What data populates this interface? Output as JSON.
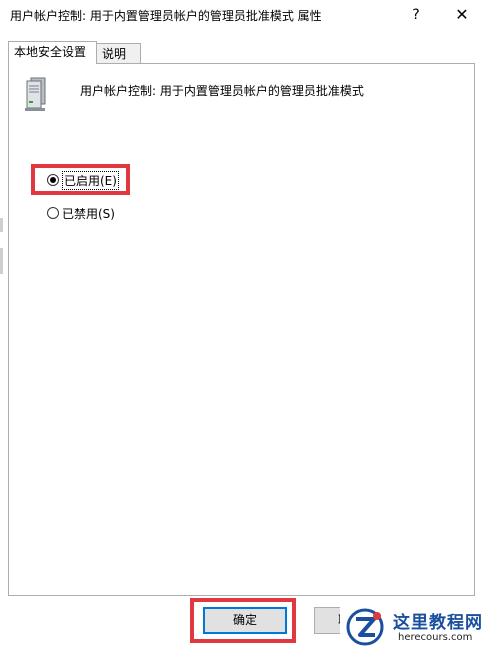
{
  "window": {
    "title": "用户帐户控制: 用于内置管理员帐户的管理员批准模式 属性",
    "help_label": "?",
    "close_label": "✕"
  },
  "tabs": [
    {
      "label": "本地安全设置",
      "active": true
    },
    {
      "label": "说明",
      "active": false
    }
  ],
  "policy": {
    "icon": "server-icon",
    "name": "用户帐户控制: 用于内置管理员帐户的管理员批准模式"
  },
  "options": [
    {
      "label": "已启用(E)",
      "checked": true
    },
    {
      "label": "已禁用(S)",
      "checked": false
    }
  ],
  "buttons": {
    "ok": "确定",
    "cancel": "取"
  },
  "watermark": {
    "site_name": "这里教程网",
    "url": "herecours.com"
  },
  "colors": {
    "highlight": "#e0383e",
    "focus_border": "#0078d7",
    "watermark_text": "#1a4fa0"
  }
}
